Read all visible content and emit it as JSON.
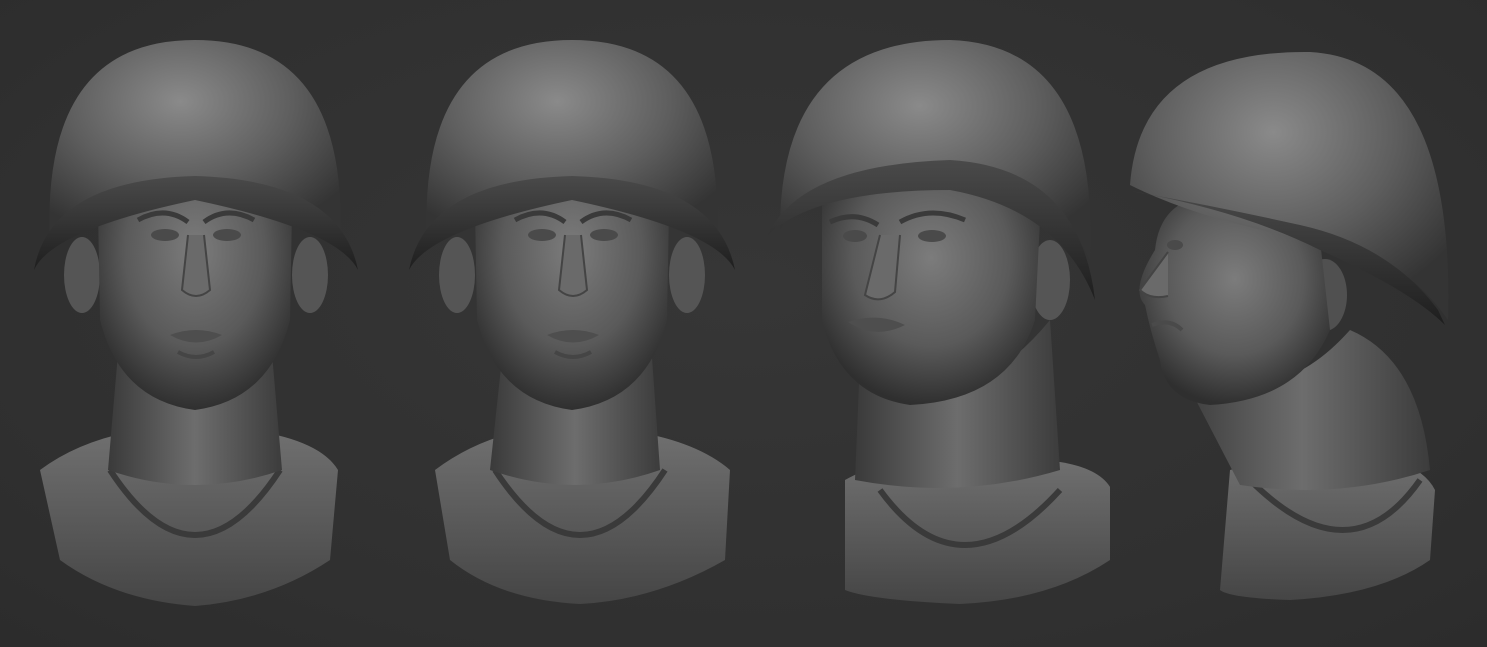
{
  "scene": {
    "background": "#323232",
    "material": "clay-grey",
    "subject": "soldier-bust-with-helmet",
    "views": [
      {
        "id": "front-left-light",
        "angle": "front"
      },
      {
        "id": "front-right-light",
        "angle": "front"
      },
      {
        "id": "three-quarter",
        "angle": "three-quarter-left"
      },
      {
        "id": "profile",
        "angle": "side-left"
      }
    ]
  }
}
